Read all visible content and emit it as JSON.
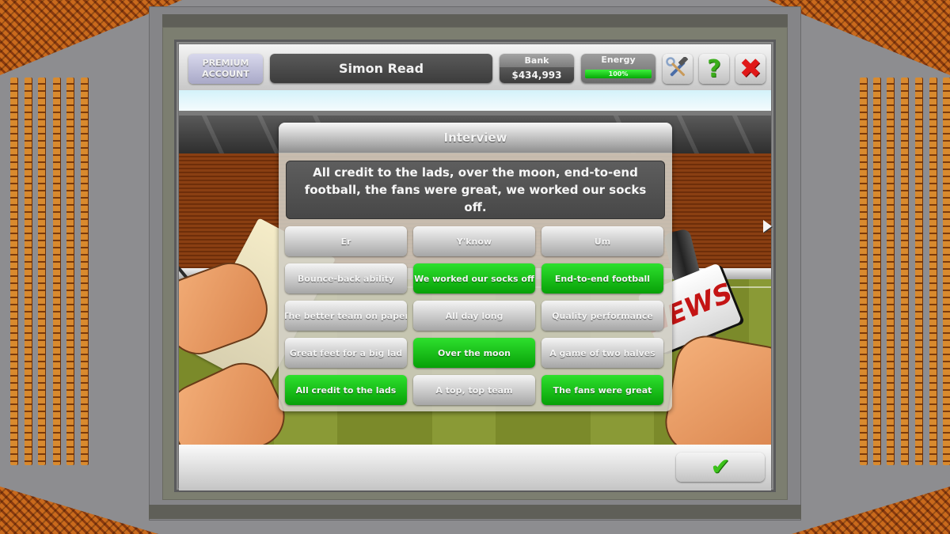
{
  "header": {
    "account_badge": "PREMIUM ACCOUNT",
    "manager_name": "Simon Read",
    "bank_label": "Bank",
    "bank_value": "$434,993",
    "energy_label": "Energy",
    "energy_value": "100%",
    "energy_fraction": 1.0,
    "icons": {
      "tools": "tools-icon",
      "help": "help-icon",
      "close": "close-icon"
    }
  },
  "scene": {
    "news_card_text": "NEWS"
  },
  "interview": {
    "title": "Interview",
    "quote": "All credit to the lads, over the moon, end-to-end football, the fans were great, we worked our socks off.",
    "phrases": [
      {
        "label": "Er",
        "selected": false
      },
      {
        "label": "Y'know",
        "selected": false
      },
      {
        "label": "Um",
        "selected": false
      },
      {
        "label": "Bounce-back ability",
        "selected": false
      },
      {
        "label": "We worked our socks off",
        "selected": true
      },
      {
        "label": "End-to-end football",
        "selected": true
      },
      {
        "label": "The better team on paper",
        "selected": false
      },
      {
        "label": "All day long",
        "selected": false
      },
      {
        "label": "Quality performance",
        "selected": false
      },
      {
        "label": "Great feet for a big lad",
        "selected": false
      },
      {
        "label": "Over the moon",
        "selected": true
      },
      {
        "label": "A game of two halves",
        "selected": false
      },
      {
        "label": "All credit to the lads",
        "selected": true
      },
      {
        "label": "A top, top team",
        "selected": false
      },
      {
        "label": "The fans were great",
        "selected": true
      }
    ]
  },
  "footer": {
    "confirm_icon": "checkmark-icon"
  },
  "colors": {
    "selected_green": "#0cb00c",
    "unselected_grey": "#b8b8b8",
    "close_red": "#e01818",
    "help_green": "#3aae1a"
  }
}
